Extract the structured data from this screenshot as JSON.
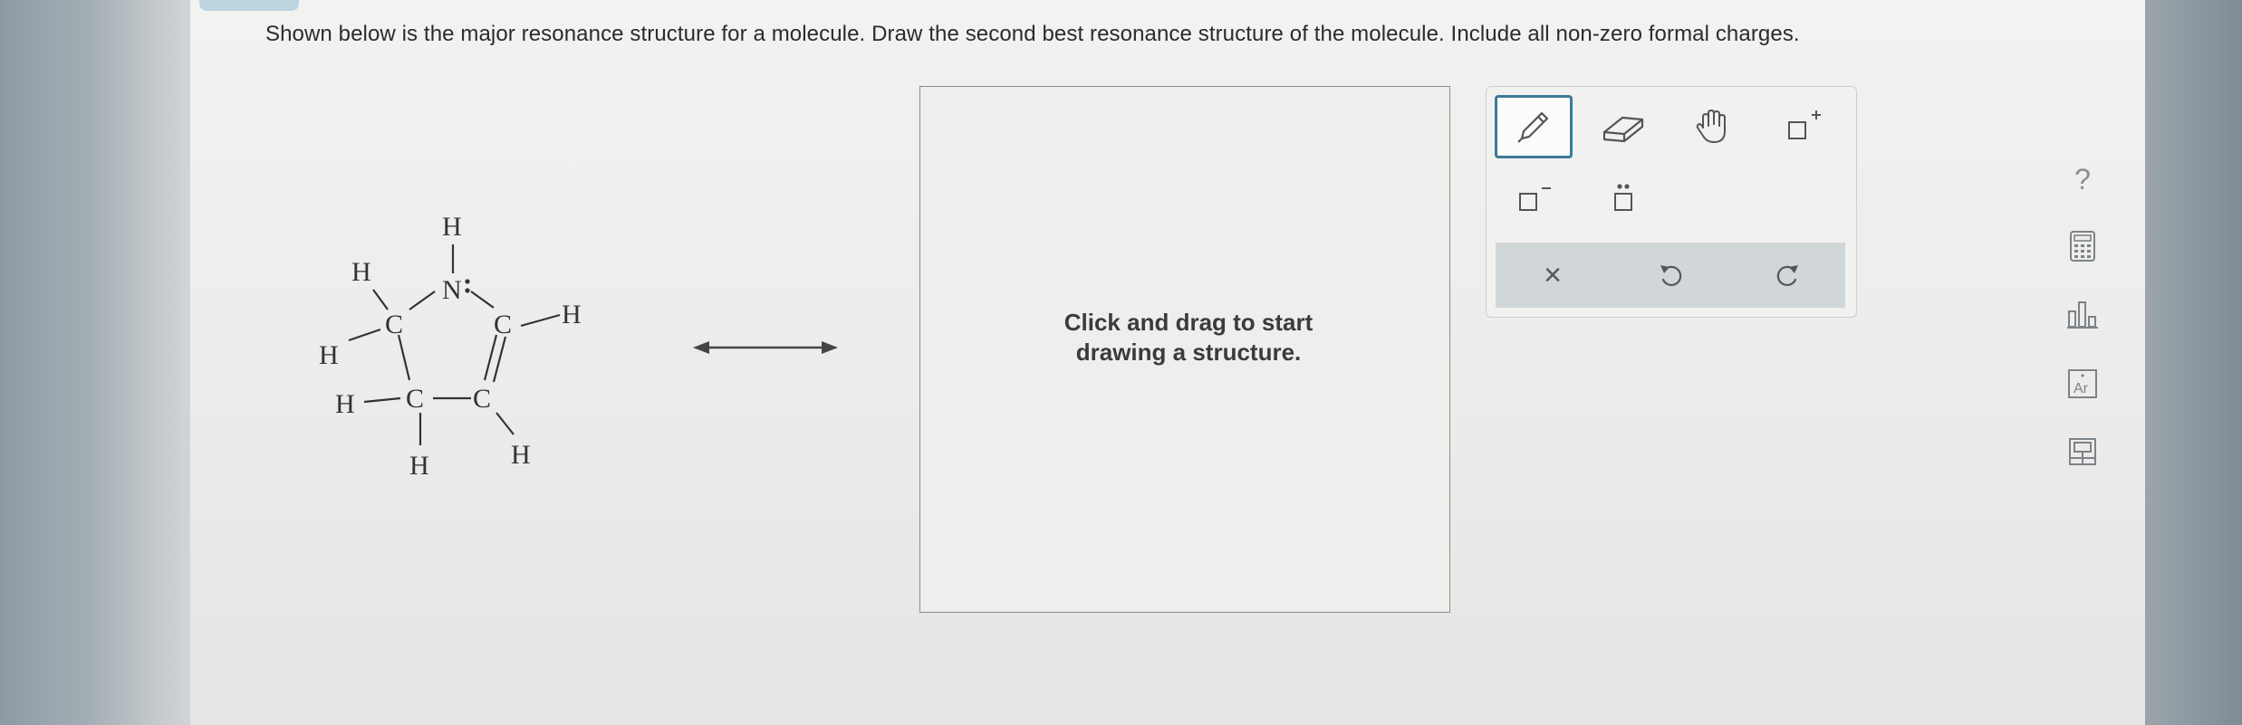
{
  "question": {
    "text": "Shown below is the major resonance structure for a molecule. Draw the second best resonance structure of the molecule. Include all non-zero formal charges."
  },
  "molecule": {
    "atoms": {
      "h_top": "H",
      "n": "N",
      "h_upper_left": "H",
      "c_left": "C",
      "h_left": "H",
      "c_right": "C",
      "h_right": "H",
      "c_bottom_left": "C",
      "h_bottom_left_side": "H",
      "h_bottom_left_down": "H",
      "c_bottom_right": "C",
      "h_bottom_right": "H"
    }
  },
  "canvas": {
    "hint": "Click and drag to start drawing a structure."
  },
  "toolbar": {
    "tools": [
      "pencil-icon",
      "eraser-icon",
      "hand-icon",
      "plus-charge-icon",
      "minus-charge-icon",
      "lone-pair-icon"
    ],
    "actions": {
      "clear": "×",
      "undo": "undo-icon",
      "redo": "redo-icon"
    },
    "accent": "#3c7a95"
  },
  "sidebar": {
    "help": "?",
    "tools": [
      "calculator-icon",
      "chart-icon",
      "periodic-table-icon",
      "reference-icon"
    ]
  }
}
